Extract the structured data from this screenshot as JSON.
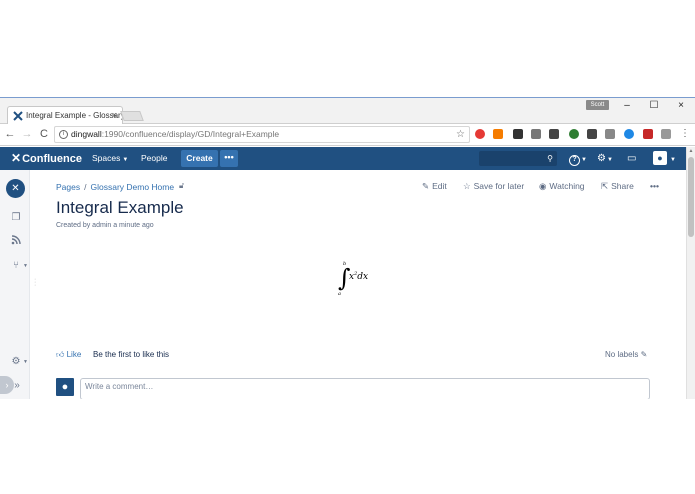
{
  "browser": {
    "tab_title": "Integral Example - Glossary",
    "tab_close": "×",
    "user_chip": "Scott",
    "window": {
      "minimize": "–",
      "maximize": "☐",
      "close": "×"
    },
    "nav": {
      "back": "←",
      "forward": "→",
      "reload": "C"
    },
    "url_host": "dingwall",
    "url_rest": ":1990/confluence/display/GD/Integral+Example",
    "menu": "⋮",
    "extension_colors": [
      "#e53935",
      "#f57c00",
      "#333333",
      "#777777",
      "#444444",
      "#2e7d32",
      "#444444",
      "#888888",
      "#1e88e5",
      "#c62828",
      "#999999",
      "#1565c0"
    ]
  },
  "header": {
    "logo": "Confluence",
    "spaces": "Spaces",
    "people": "People",
    "create": "Create",
    "more": "•••",
    "search_icon": "🔍",
    "help_icon": "?",
    "settings_icon": "⚙",
    "notifications_icon": "▭",
    "user_icon": "👤"
  },
  "sidebar": {
    "space_logo": "✕",
    "pages_icon": "❐",
    "feed_icon": "☰",
    "tree_icon": "⑂",
    "settings_icon": "⚙",
    "expand": "»"
  },
  "breadcrumb": {
    "pages": "Pages",
    "sep": "/",
    "space": "Glossary Demo Home"
  },
  "actions": {
    "edit": "Edit",
    "save": "Save for later",
    "watching": "Watching",
    "share": "Share",
    "more": "•••"
  },
  "page": {
    "title": "Integral Example",
    "byline": "Created by admin a minute ago",
    "formula": {
      "integral": "∫",
      "upper": "b",
      "lower": "a",
      "base": "x",
      "exp": "2",
      "tail": "dx"
    }
  },
  "footer": {
    "like": "Like",
    "like_text": "Be the first to like this",
    "labels": "No labels",
    "comment_placeholder": "Write a comment…"
  }
}
